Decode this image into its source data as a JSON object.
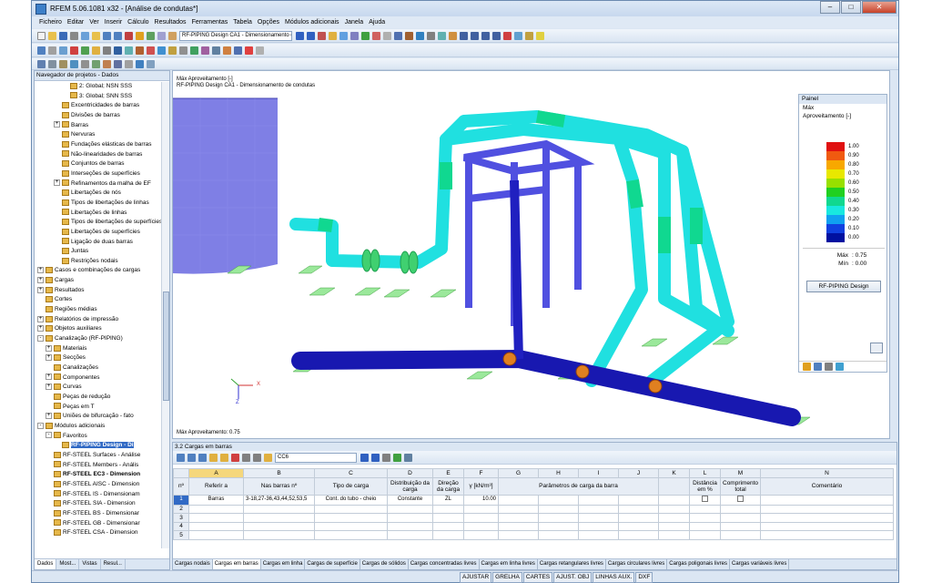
{
  "window": {
    "title": "RFEM 5.06.1081 x32 - [Análise de condutas*]",
    "buttons": [
      "‒",
      "□",
      "✕"
    ]
  },
  "menu": [
    "Ficheiro",
    "Editar",
    "Ver",
    "Inserir",
    "Cálculo",
    "Resultados",
    "Ferramentas",
    "Tabela",
    "Opções",
    "Módulos adicionais",
    "Janela",
    "Ajuda"
  ],
  "toolbar": {
    "case_selector": "RF-PIPING Design CA1 - Dimensionamento de condutas"
  },
  "navigator": {
    "title": "Navegador de projetos - Dados",
    "items": [
      {
        "label": "2: Global; NSN SSS",
        "indent": 4,
        "exp": ""
      },
      {
        "label": "3: Global; SNN SSS",
        "indent": 4,
        "exp": ""
      },
      {
        "label": "Excentricidades de barras",
        "indent": 3,
        "exp": ""
      },
      {
        "label": "Divisões de barras",
        "indent": 3,
        "exp": ""
      },
      {
        "label": "Barras",
        "indent": 3,
        "exp": "+"
      },
      {
        "label": "Nervuras",
        "indent": 3,
        "exp": ""
      },
      {
        "label": "Fundações elásticas de barras",
        "indent": 3,
        "exp": ""
      },
      {
        "label": "Não-linearidades de barras",
        "indent": 3,
        "exp": ""
      },
      {
        "label": "Conjuntos de barras",
        "indent": 3,
        "exp": ""
      },
      {
        "label": "Interseções de superfícies",
        "indent": 3,
        "exp": ""
      },
      {
        "label": "Refinamentos da malha de EF",
        "indent": 3,
        "exp": "+"
      },
      {
        "label": "Libertações de nós",
        "indent": 3,
        "exp": ""
      },
      {
        "label": "Tipos de libertações de linhas",
        "indent": 3,
        "exp": ""
      },
      {
        "label": "Libertações de linhas",
        "indent": 3,
        "exp": ""
      },
      {
        "label": "Tipos de libertações de superfícies",
        "indent": 3,
        "exp": ""
      },
      {
        "label": "Libertações de superfícies",
        "indent": 3,
        "exp": ""
      },
      {
        "label": "Ligação de duas barras",
        "indent": 3,
        "exp": ""
      },
      {
        "label": "Juntas",
        "indent": 3,
        "exp": ""
      },
      {
        "label": "Restrições nodais",
        "indent": 3,
        "exp": ""
      },
      {
        "label": "Casos e combinações de cargas",
        "indent": 1,
        "exp": "+"
      },
      {
        "label": "Cargas",
        "indent": 1,
        "exp": "+"
      },
      {
        "label": "Resultados",
        "indent": 1,
        "exp": "+"
      },
      {
        "label": "Cortes",
        "indent": 1,
        "exp": ""
      },
      {
        "label": "Regiões médias",
        "indent": 1,
        "exp": ""
      },
      {
        "label": "Relatórios de impressão",
        "indent": 1,
        "exp": "+"
      },
      {
        "label": "Objetos auxiliares",
        "indent": 1,
        "exp": "+"
      },
      {
        "label": "Canalização (RF-PIPING)",
        "indent": 1,
        "exp": "-"
      },
      {
        "label": "Materiais",
        "indent": 2,
        "exp": "+"
      },
      {
        "label": "Secções",
        "indent": 2,
        "exp": "+"
      },
      {
        "label": "Canalizações",
        "indent": 2,
        "exp": ""
      },
      {
        "label": "Componentes",
        "indent": 2,
        "exp": "+"
      },
      {
        "label": "Curvas",
        "indent": 2,
        "exp": "+"
      },
      {
        "label": "Peças de redução",
        "indent": 2,
        "exp": ""
      },
      {
        "label": "Peças em T",
        "indent": 2,
        "exp": ""
      },
      {
        "label": "Uniões de bifurcação - fato",
        "indent": 2,
        "exp": "+"
      },
      {
        "label": "Módulos adicionais",
        "indent": 1,
        "exp": "-"
      },
      {
        "label": "Favoritos",
        "indent": 2,
        "exp": "-"
      },
      {
        "label": "RF-PIPING Design - Di",
        "indent": 3,
        "exp": "",
        "hl": true,
        "bold": true
      },
      {
        "label": "RF-STEEL Surfaces - Análise",
        "indent": 2,
        "exp": ""
      },
      {
        "label": "RF-STEEL Members - Anális",
        "indent": 2,
        "exp": ""
      },
      {
        "label": "RF-STEEL EC3 - Dimension",
        "indent": 2,
        "exp": "",
        "bold": true
      },
      {
        "label": "RF-STEEL AISC - Dimension",
        "indent": 2,
        "exp": ""
      },
      {
        "label": "RF-STEEL IS - Dimensionam",
        "indent": 2,
        "exp": ""
      },
      {
        "label": "RF-STEEL SIA - Dimension",
        "indent": 2,
        "exp": ""
      },
      {
        "label": "RF-STEEL BS - Dimensionar",
        "indent": 2,
        "exp": ""
      },
      {
        "label": "RF-STEEL GB - Dimensionar",
        "indent": 2,
        "exp": ""
      },
      {
        "label": "RF-STEEL CSA - Dimension",
        "indent": 2,
        "exp": ""
      }
    ],
    "tabs": [
      "Dados",
      "Most...",
      "Vistas",
      "Resul..."
    ]
  },
  "view": {
    "line1": "Máx Aproveitamento [-]",
    "line2": "RF-PIPING Design CA1 - Dimensionamento de condutas",
    "footer": "Máx Aproveitamento: 0.75",
    "axes": {
      "x": "X",
      "z": "Z"
    }
  },
  "panel": {
    "title": "Painel",
    "l1": "Máx",
    "l2": "Aproveitamento [-]",
    "legend": [
      {
        "v": "1.00",
        "c": "#e01010"
      },
      {
        "v": "0.90",
        "c": "#f05a10"
      },
      {
        "v": "0.80",
        "c": "#f8a800"
      },
      {
        "v": "0.70",
        "c": "#e8e800"
      },
      {
        "v": "0.60",
        "c": "#98e000"
      },
      {
        "v": "0.50",
        "c": "#20d020"
      },
      {
        "v": "0.40",
        "c": "#10d890"
      },
      {
        "v": "0.30",
        "c": "#18e8e0"
      },
      {
        "v": "0.20",
        "c": "#10a0f0"
      },
      {
        "v": "0.10",
        "c": "#1040e0"
      },
      {
        "v": "0.00",
        "c": "#0010a0"
      }
    ],
    "max_label": "Máx",
    "max_value": ": 0.75",
    "min_label": "Mín",
    "min_value": ": 0.00",
    "button": "RF-PIPING Design"
  },
  "table": {
    "title": "3.2 Cargas em barras",
    "load_case": "CC6",
    "columns": [
      "A",
      "B",
      "C",
      "D",
      "E",
      "F",
      "G",
      "H",
      "I",
      "J",
      "K",
      "L",
      "M",
      "N"
    ],
    "h_nr": "nº",
    "h_a": "Referir a",
    "h_b": "Nas barras nº",
    "h_c": "Tipo de carga",
    "h_d": "Distribuição da carga",
    "h_e": "Direção da carga",
    "h_f": "γ [kN/m³]",
    "h_ghij": "Parâmetros de carga da barra",
    "h_l": "Distância em %",
    "h_m": "Comprimento total",
    "h_n": "Comentário",
    "rows": [
      {
        "nr": "1",
        "a": "Barras",
        "b": "3-18,27-36,43,44,52,53,5",
        "c": "Cont. do tubo - cheio",
        "d": "Constante",
        "e": "ZL",
        "f": "10.00"
      },
      {
        "nr": "2",
        "a": "",
        "b": "",
        "c": "",
        "d": "",
        "e": "",
        "f": ""
      },
      {
        "nr": "3",
        "a": "",
        "b": "",
        "c": "",
        "d": "",
        "e": "",
        "f": ""
      },
      {
        "nr": "4",
        "a": "",
        "b": "",
        "c": "",
        "d": "",
        "e": "",
        "f": ""
      },
      {
        "nr": "5",
        "a": "",
        "b": "",
        "c": "",
        "d": "",
        "e": "",
        "f": ""
      }
    ],
    "tabs": [
      "Cargas nodais",
      "Cargas em barras",
      "Cargas em linha",
      "Cargas de superfície",
      "Cargas de sólidos",
      "Cargas concentradas livres",
      "Cargas em linha livres",
      "Cargas retangulares livres",
      "Cargas circulares livres",
      "Cargas poligonais livres",
      "Cargas variáveis livres"
    ]
  },
  "status": [
    "AJUSTAR",
    "GRELHA",
    "CARTES",
    "AJUST. OBJ",
    "LINHAS AUX.",
    "DXF"
  ]
}
